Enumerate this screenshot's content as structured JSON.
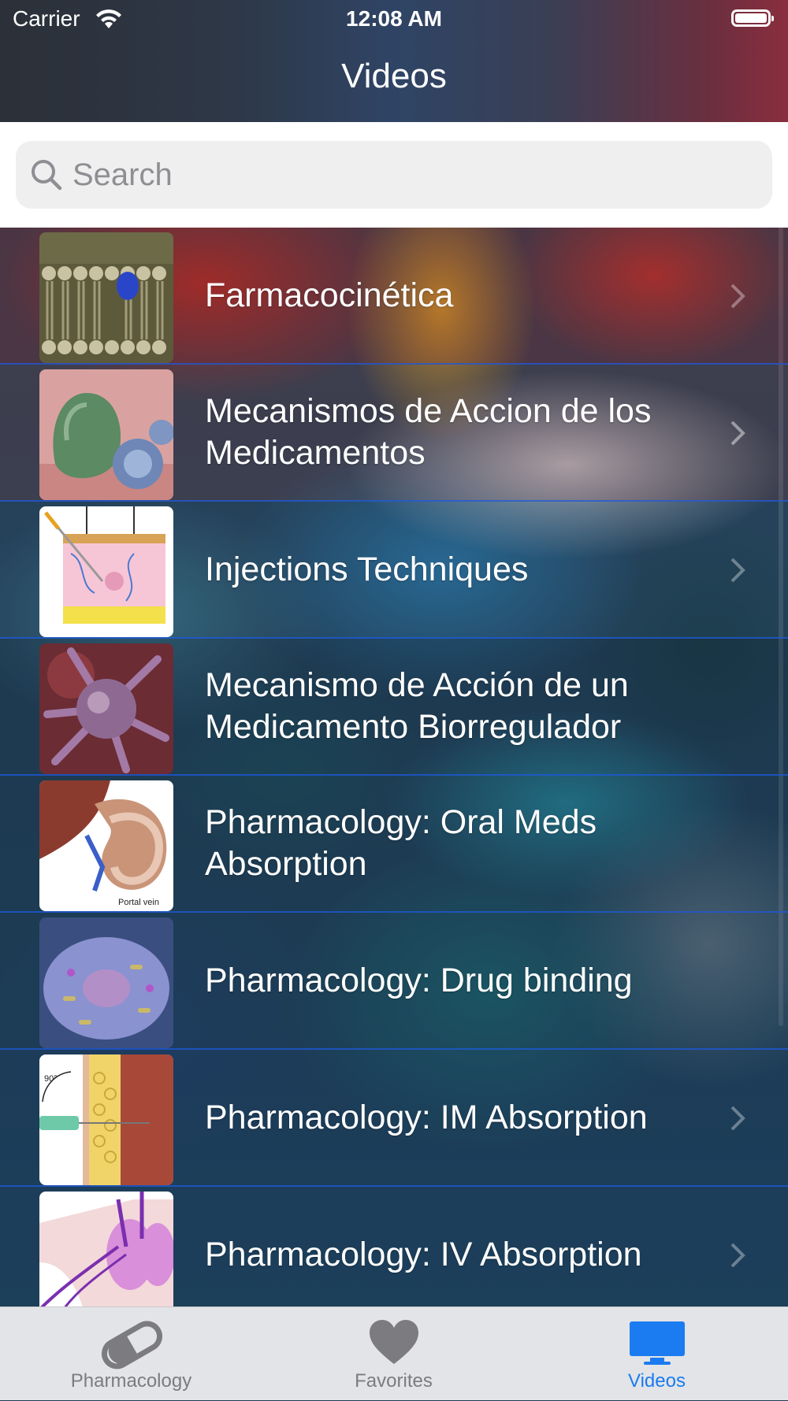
{
  "status_bar": {
    "carrier": "Carrier",
    "time": "12:08 AM"
  },
  "nav": {
    "title": "Videos"
  },
  "search": {
    "placeholder": "Search"
  },
  "videos": [
    {
      "title": "Farmacocinética",
      "thumbnail_icon": "cell-membrane-thumbnail"
    },
    {
      "title": "Mecanismos de Accion de los Medicamentos",
      "thumbnail_icon": "cells-thumbnail"
    },
    {
      "title": "Injections Techniques",
      "thumbnail_icon": "skin-layers-thumbnail"
    },
    {
      "title": "Mecanismo de Acción de un Medicamento Biorregulador",
      "thumbnail_icon": "virus-cell-thumbnail"
    },
    {
      "title": "Pharmacology: Oral Meds Absorption",
      "thumbnail_icon": "stomach-liver-thumbnail",
      "thumbnail_caption": "Portal vein"
    },
    {
      "title": "Pharmacology: Drug binding",
      "thumbnail_icon": "cell-organelles-thumbnail"
    },
    {
      "title": "Pharmacology: IM Absorption",
      "thumbnail_icon": "needle-muscle-thumbnail",
      "thumbnail_caption": "90°"
    },
    {
      "title": "Pharmacology: IV Absorption",
      "thumbnail_icon": "lungs-veins-thumbnail"
    }
  ],
  "tabbar": {
    "items": [
      {
        "label": "Pharmacology",
        "icon": "pill-icon",
        "active": false
      },
      {
        "label": "Favorites",
        "icon": "heart-icon",
        "active": false
      },
      {
        "label": "Videos",
        "icon": "monitor-icon",
        "active": true
      }
    ],
    "active_color": "#1a7cf0",
    "inactive_color": "#7c7c80"
  }
}
